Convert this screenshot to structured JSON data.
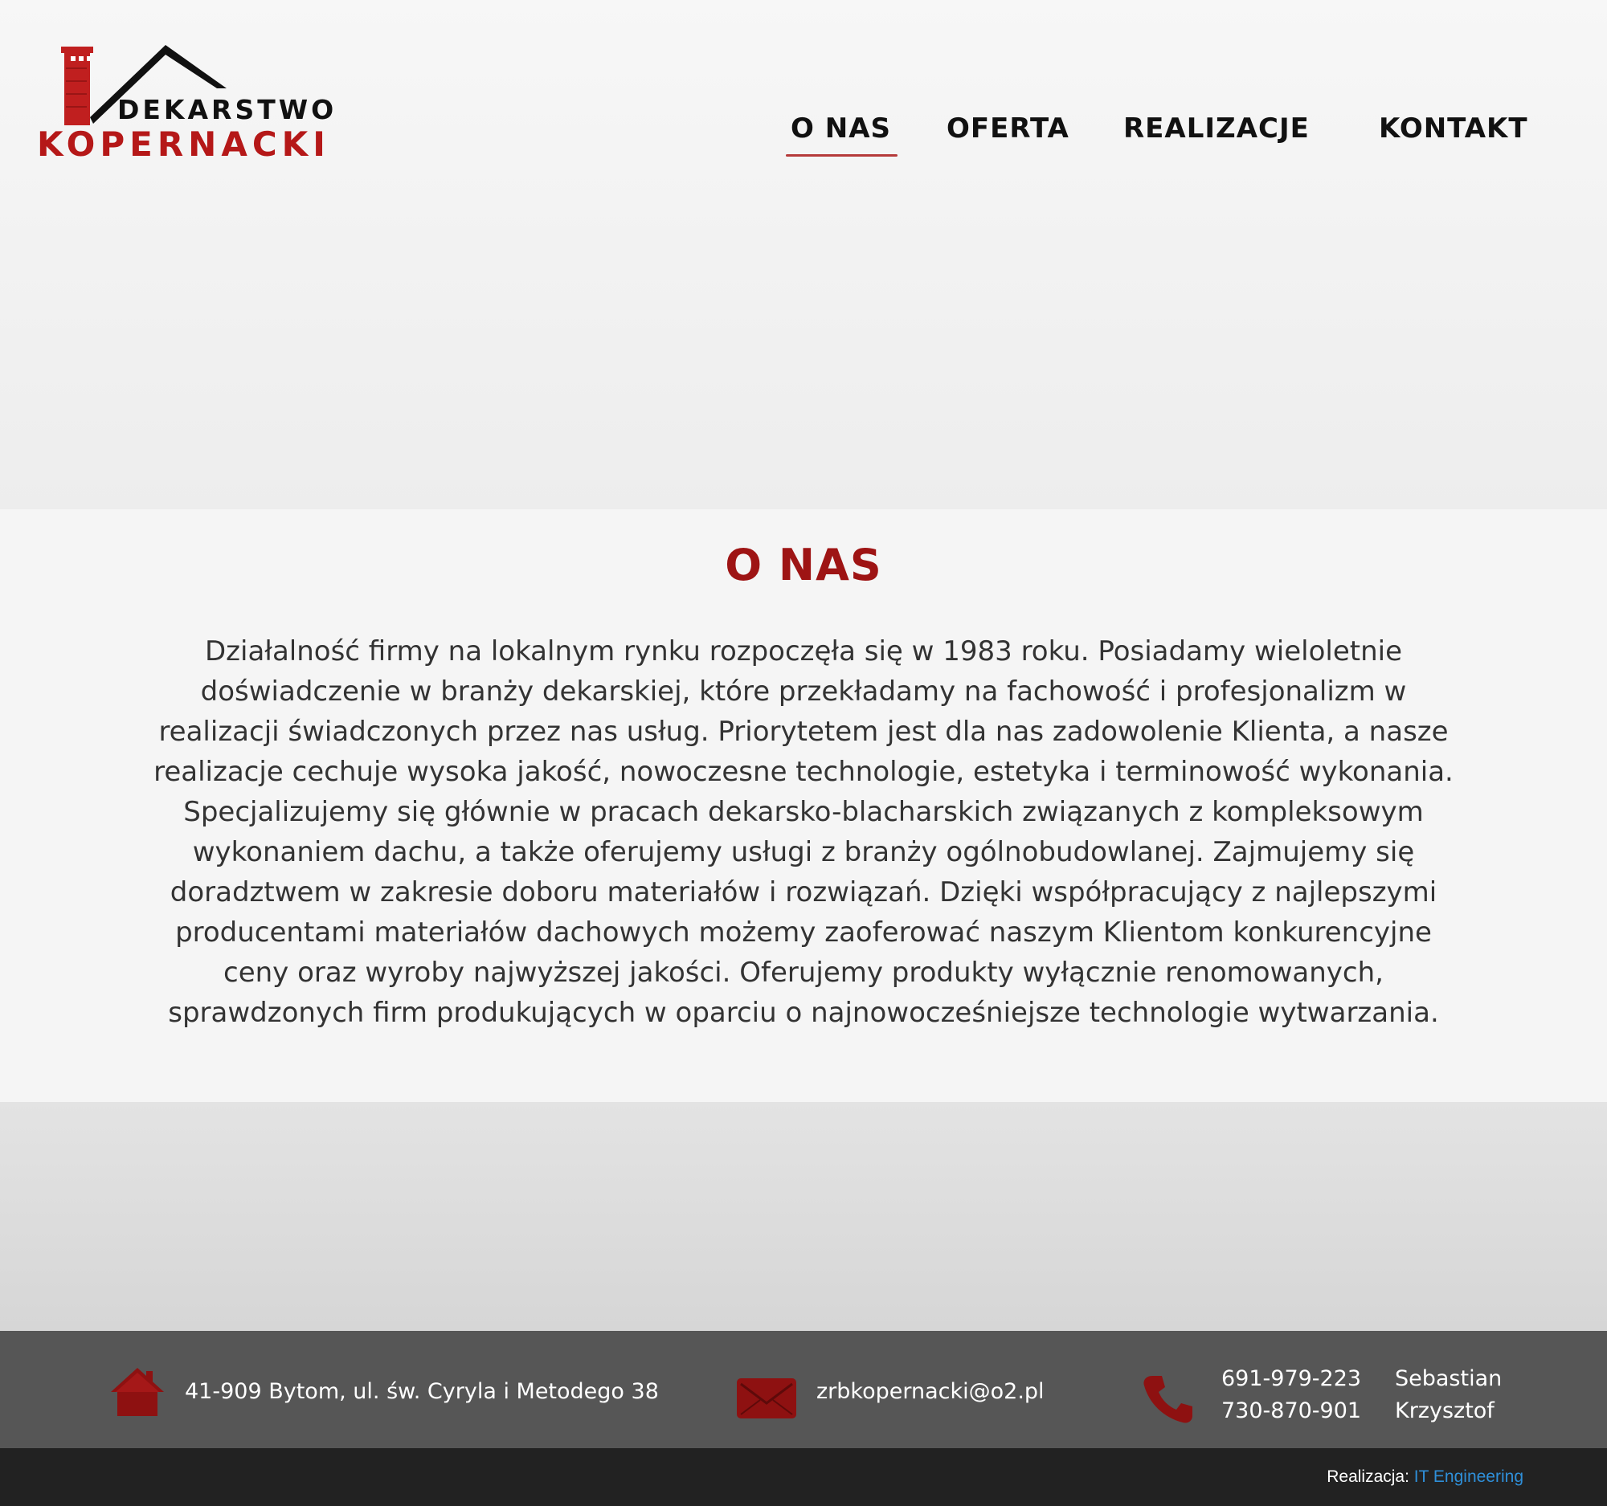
{
  "logo": {
    "line1": "DEKARSTWO",
    "line2": "KOPERNACKI"
  },
  "nav": {
    "items": [
      {
        "label": "O NAS",
        "active": true
      },
      {
        "label": "OFERTA",
        "active": false
      },
      {
        "label": "REALIZACJE",
        "active": false
      },
      {
        "label": "KONTAKT",
        "active": false
      }
    ]
  },
  "about": {
    "title": "O NAS",
    "lines": [
      "Działalność firmy na lokalnym rynku rozpoczęła się w 1983 roku. Posiadamy wieloletnie",
      "doświadczenie w branży dekarskiej, które przekładamy na fachowość i profesjonalizm w",
      "realizacji świadczonych przez nas usług. Priorytetem jest dla nas zadowolenie Klienta, a nasze",
      "realizacje cechuje wysoka jakość, nowoczesne technologie, estetyka i terminowość wykonania.",
      "Specjalizujemy się głównie w pracach dekarsko-blacharskich związanych z kompleksowym",
      "wykonaniem dachu, a także oferujemy usługi z branży ogólnobudowlanej. Zajmujemy się",
      "doradztwem w zakresie doboru materiałów i rozwiązań. Dzięki współpracujący  z najlepszymi",
      "producentami materiałów dachowych możemy zaoferować naszym Klientom konkurencyjne",
      "ceny oraz wyroby najwyższej jakości. Oferujemy produkty wyłącznie renomowanych,",
      "sprawdzonych firm produkujących w oparciu o najnowocześniejsze technologie wytwarzania."
    ]
  },
  "footer": {
    "address": "41-909 Bytom, ul. św. Cyryla i Metodego 38",
    "email": "zrbkopernacki@o2.pl",
    "phones": [
      {
        "number": "691-979-223",
        "name": "Sebastian"
      },
      {
        "number": "730-870-901",
        "name": "Krzysztof"
      }
    ],
    "icons": {
      "address": "home-icon",
      "email": "envelope-icon",
      "phone": "phone-icon"
    }
  },
  "credit": {
    "prefix": "Realizacja:",
    "link": "IT Engineering"
  },
  "colors": {
    "brand_red": "#9e1414",
    "link_blue": "#2f8fd8",
    "footer_bg": "#565656",
    "bottom_bg": "#222222"
  }
}
